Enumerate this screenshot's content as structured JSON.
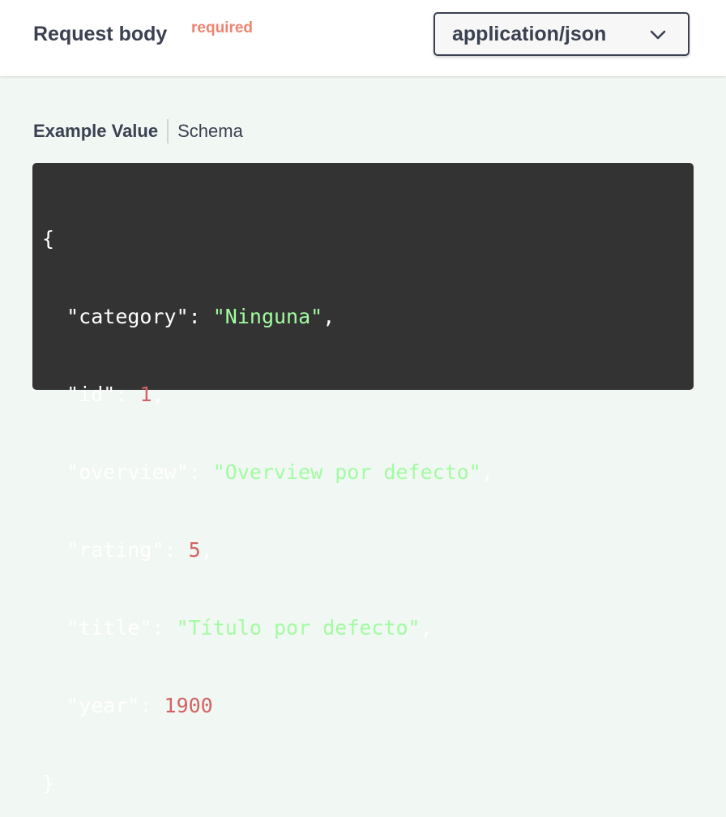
{
  "header": {
    "title": "Request body",
    "required_label": "required",
    "content_type": {
      "selected": "application/json",
      "icon": "chevron-down-icon"
    }
  },
  "tabs": [
    {
      "label": "Example Value",
      "active": true
    },
    {
      "label": "Schema",
      "active": false
    }
  ],
  "example": {
    "open_brace": "{",
    "close_brace": "}",
    "fields": [
      {
        "key": "\"category\"",
        "value": "\"Ninguna\"",
        "type": "string"
      },
      {
        "key": "\"id\"",
        "value": "1",
        "type": "number"
      },
      {
        "key": "\"overview\"",
        "value": "\"Overview por defecto\"",
        "type": "string"
      },
      {
        "key": "\"rating\"",
        "value": "5",
        "type": "number"
      },
      {
        "key": "\"title\"",
        "value": "\"Título por defecto\"",
        "type": "string"
      },
      {
        "key": "\"year\"",
        "value": "1900",
        "type": "number"
      }
    ]
  },
  "colors": {
    "text": "#3b4151",
    "required": "#f0836f",
    "code_bg": "#333333",
    "string": "#a2fca2",
    "number": "#d36363",
    "panel_bg": "#f1f7f3"
  }
}
